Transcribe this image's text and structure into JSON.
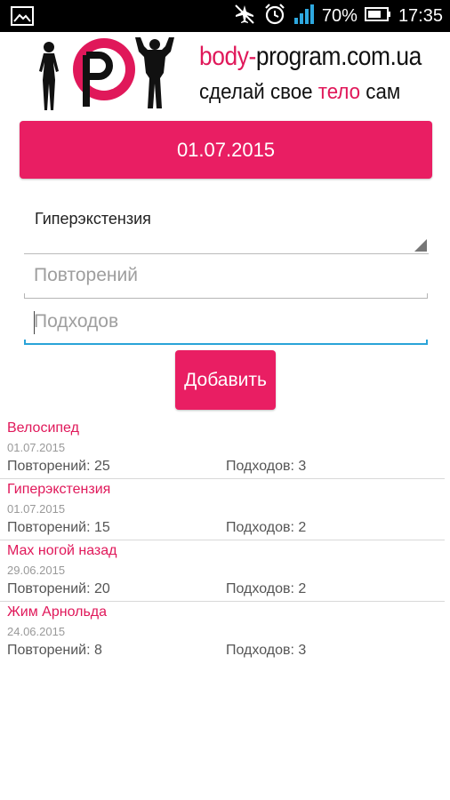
{
  "status_bar": {
    "battery_percent": "70%",
    "time": "17:35",
    "icons": [
      "gallery-icon",
      "airplane-mode-icon",
      "alarm-icon",
      "signal-icon",
      "battery-icon"
    ]
  },
  "header": {
    "logo_letter": "P",
    "site_name_part1": "body-",
    "site_name_part2": "program.com.ua",
    "slogan_part1": "сделай свое ",
    "slogan_part2": "тело",
    "slogan_part3": " сам"
  },
  "colors": {
    "accent": "#e91e63",
    "focus": "#29a3d8"
  },
  "date_button": {
    "label": "01.07.2015"
  },
  "exercise_spinner": {
    "selected": "Гиперэкстензия"
  },
  "reps_input": {
    "placeholder": "Повторений"
  },
  "sets_input": {
    "placeholder": "Подходов"
  },
  "add_button": {
    "label": "Добавить"
  },
  "entries": [
    {
      "name": "Велосипед",
      "date": "01.07.2015",
      "reps": "Повторений: 25",
      "sets": "Подходов: 3"
    },
    {
      "name": "Гиперэкстензия",
      "date": "01.07.2015",
      "reps": "Повторений: 15",
      "sets": "Подходов: 2"
    },
    {
      "name": "Мах ногой назад",
      "date": "29.06.2015",
      "reps": "Повторений: 20",
      "sets": "Подходов: 2"
    },
    {
      "name": "Жим Арнольда",
      "date": "24.06.2015",
      "reps": "Повторений: 8",
      "sets": "Подходов: 3"
    }
  ]
}
